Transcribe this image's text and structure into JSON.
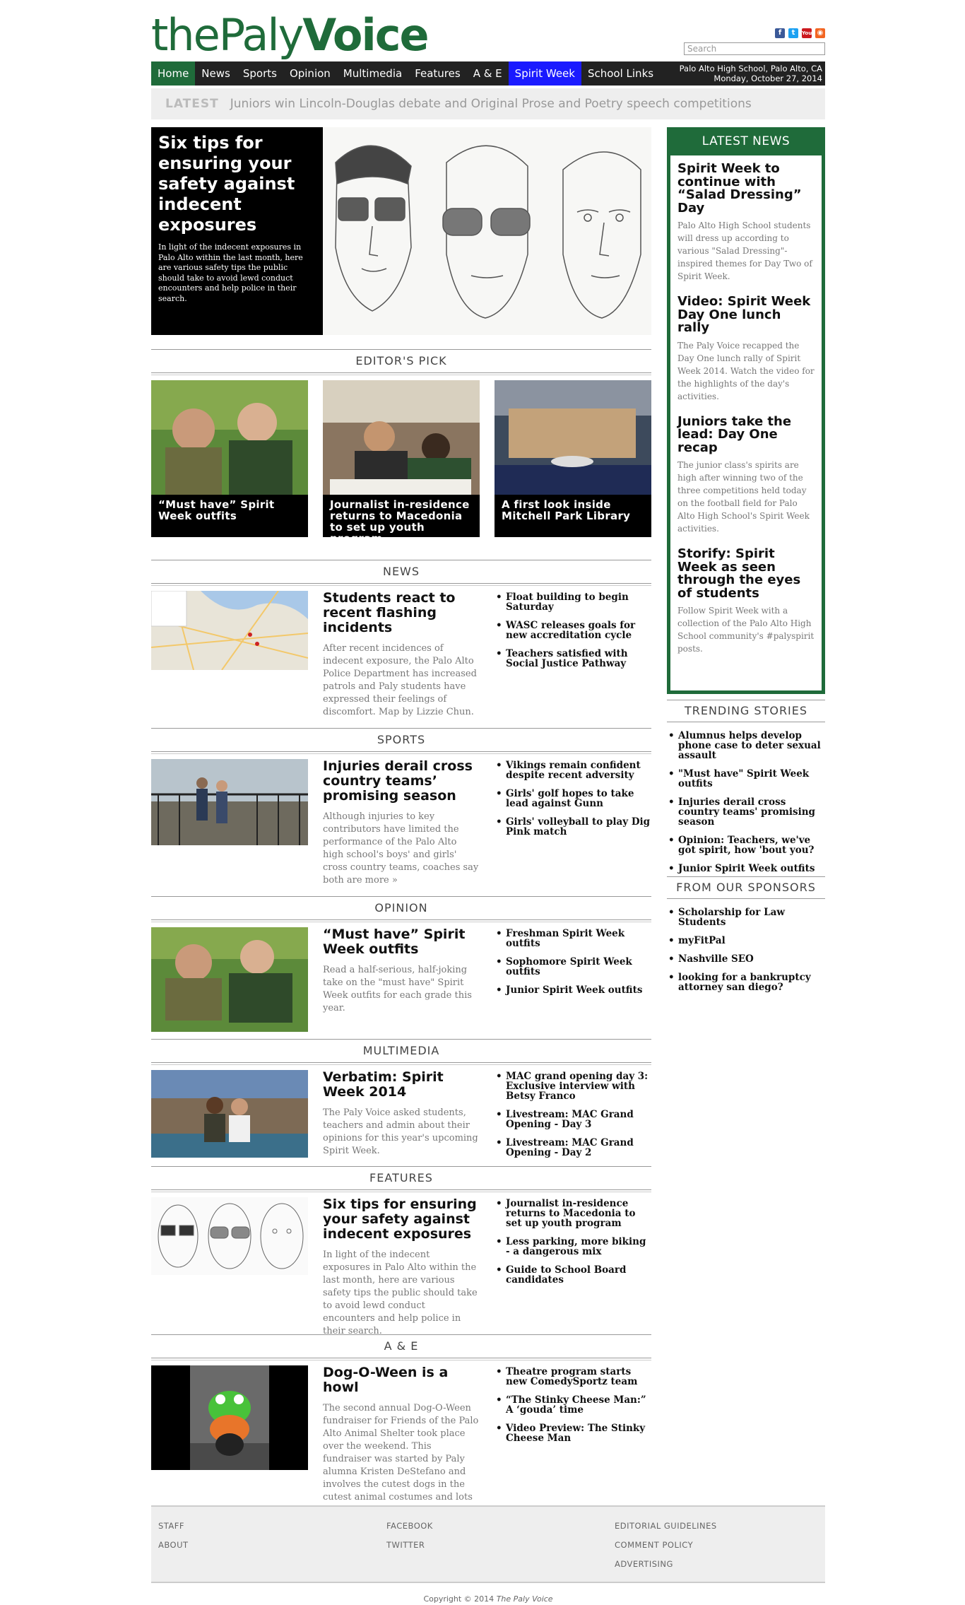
{
  "brand": {
    "logo_light": "thePaly",
    "logo_bold": "Voice",
    "colors": {
      "brand_green": "#1f6b3a",
      "spirit_blue": "#1a1aff",
      "nav_bg": "#222222"
    }
  },
  "header": {
    "social": [
      "facebook-icon",
      "twitter-icon",
      "youtube-icon",
      "rss-icon"
    ],
    "search_placeholder": "Search",
    "location": "Palo Alto High School, Palo Alto, CA",
    "date": "Monday, October 27, 2014"
  },
  "nav": [
    "Home",
    "News",
    "Sports",
    "Opinion",
    "Multimedia",
    "Features",
    "A & E",
    "Spirit Week",
    "School Links"
  ],
  "latest": {
    "label": "LATEST",
    "text": "Juniors win Lincoln-Douglas debate and Original Prose and Poetry speech competitions"
  },
  "hero": {
    "title": "Six tips for ensuring your safety against indecent exposures",
    "body": "In light of the indecent exposures in Palo Alto within the last month, here are various safety tips the public should take to avoid lewd conduct encounters and help police in their search."
  },
  "editors_pick": {
    "heading": "EDITOR'S PICK",
    "items": [
      "“Must have” Spirit Week outfits",
      "Journalist in-residence returns to Macedonia to set up youth program",
      "A first look inside Mitchell Park Library"
    ]
  },
  "sections": [
    {
      "heading": "NEWS",
      "title": "Students react to recent flashing incidents",
      "body": "After recent incidences of indecent exposure, the Palo Alto Police Department has increased patrols and Paly students have expressed their feelings of discomfort. Map by Lizzie Chun.",
      "related": [
        "Float building to begin Saturday",
        "WASC releases goals for new accreditation cycle",
        "Teachers satisfied with Social Justice Pathway"
      ]
    },
    {
      "heading": "SPORTS",
      "title": "Injuries derail cross country teams’ promising season",
      "body": "Although injuries to key contributors have limited the performance of the Palo Alto high school's boys' and girls' cross country teams, coaches say both are more »",
      "related": [
        "Vikings remain confident despite recent adversity",
        "Girls' golf hopes to take lead against Gunn",
        "Girls' volleyball to play Dig Pink match"
      ]
    },
    {
      "heading": "OPINION",
      "title": "“Must have” Spirit Week outfits",
      "body": "Read a half-serious, half-joking take on the \"must have\" Spirit Week outfits for each grade this year.",
      "related": [
        "Freshman Spirit Week outfits",
        "Sophomore Spirit Week outfits",
        "Junior Spirit Week outfits"
      ]
    },
    {
      "heading": "MULTIMEDIA",
      "title": "Verbatim: Spirit Week 2014",
      "body": "The Paly Voice asked students, teachers and admin about their opinions for this year's upcoming Spirit Week.",
      "related": [
        "MAC grand opening day 3: Exclusive interview with Betsy Franco",
        "Livestream: MAC Grand Opening - Day 3",
        "Livestream: MAC Grand Opening - Day 2"
      ]
    },
    {
      "heading": "FEATURES",
      "title": "Six tips for ensuring your safety against indecent exposures",
      "body": "In light of the indecent exposures in Palo Alto within the last month, here are various safety tips the public should take to avoid lewd conduct encounters and help police in their search.",
      "related": [
        "Journalist in-residence returns to Macedonia to set up youth program",
        "Less parking, more biking - a dangerous mix",
        "Guide to School Board candidates"
      ]
    },
    {
      "heading": "A & E",
      "title": "Dog-O-Ween is a howl",
      "body": "The second annual Dog-O-Ween fundraiser for Friends of the Palo Alto Animal Shelter took place over the weekend. This fundraiser was started by Paly alumna Kristen DeStefano and involves the cutest dogs in the cutest animal costumes and lots of prizes.",
      "related": [
        "Theatre program starts new ComedySportz team",
        "“The Stinky Cheese Man:” A ‘gouda’ time",
        "Video Preview: The Stinky Cheese Man"
      ]
    }
  ],
  "latest_news": {
    "heading": "LATEST NEWS",
    "items": [
      {
        "title": "Spirit Week to continue with “Salad Dressing” Day",
        "body": "Palo Alto High School students will dress up according to various \"Salad Dressing\"-inspired themes for Day Two of Spirit Week."
      },
      {
        "title": "Video: Spirit Week Day One lunch rally",
        "body": "The Paly Voice recapped the Day One lunch rally of Spirit Week 2014. Watch the video for the highlights of the day's activities."
      },
      {
        "title": "Juniors take the lead: Day One recap",
        "body": "The junior class's spirits are high after winning two of the three competitions held today on the football field for Palo Alto High School's Spirit Week activities."
      },
      {
        "title": "Storify: Spirit Week as seen through the eyes of students",
        "body": "Follow Spirit Week with a collection of the Palo Alto High School community's #palyspirit posts."
      }
    ]
  },
  "trending": {
    "heading": "TRENDING STORIES",
    "items": [
      "Alumnus helps develop phone case to deter sexual assault",
      "\"Must have\" Spirit Week outfits",
      "Injuries derail cross country teams' promising season",
      "Opinion: Teachers, we've got spirit, how 'bout you?",
      "Junior Spirit Week outfits"
    ]
  },
  "sponsors": {
    "heading": "FROM OUR SPONSORS",
    "items": [
      "Scholarship for Law Students",
      "myFitPal",
      "Nashville SEO",
      "looking for a bankruptcy attorney san diego?"
    ]
  },
  "footer": {
    "col1": [
      "STAFF",
      "ABOUT"
    ],
    "col2": [
      "FACEBOOK",
      "TWITTER"
    ],
    "col3": [
      "EDITORIAL GUIDELINES",
      "COMMENT POLICY",
      "ADVERTISING"
    ],
    "copyright": "Copyright © 2014",
    "copyright_name": "The Paly Voice"
  }
}
